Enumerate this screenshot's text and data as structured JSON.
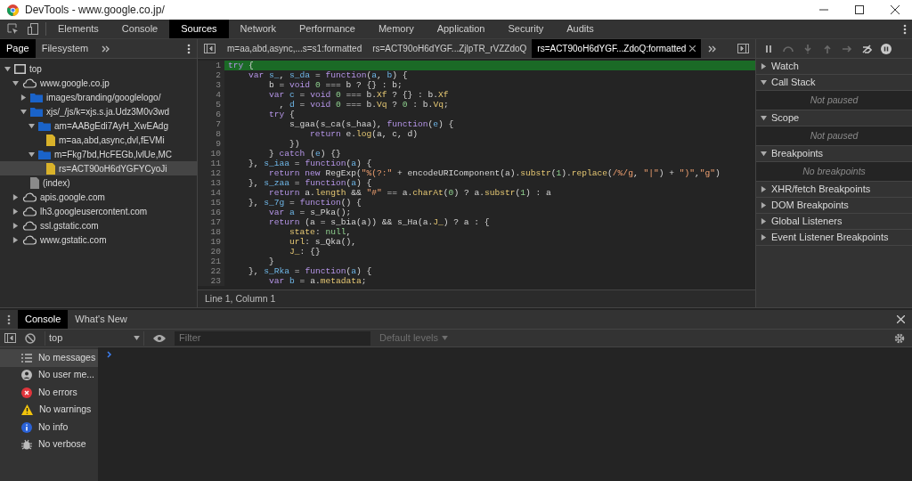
{
  "window": {
    "title": "DevTools - www.google.co.jp/"
  },
  "main_tabs": [
    {
      "label": "Elements",
      "selected": false
    },
    {
      "label": "Console",
      "selected": false
    },
    {
      "label": "Sources",
      "selected": true
    },
    {
      "label": "Network",
      "selected": false
    },
    {
      "label": "Performance",
      "selected": false
    },
    {
      "label": "Memory",
      "selected": false
    },
    {
      "label": "Application",
      "selected": false
    },
    {
      "label": "Security",
      "selected": false
    },
    {
      "label": "Audits",
      "selected": false
    }
  ],
  "navigator": {
    "tabs": [
      {
        "label": "Page",
        "selected": true
      },
      {
        "label": "Filesystem",
        "selected": false
      }
    ],
    "tree": [
      {
        "label": "top",
        "kind": "frame",
        "expanded": true,
        "selected": false,
        "children": [
          {
            "label": "www.google.co.jp",
            "kind": "domain",
            "expanded": true,
            "selected": false,
            "children": [
              {
                "label": "images/branding/googlelogo/",
                "kind": "folder",
                "expanded": false,
                "selected": false
              },
              {
                "label": "xjs/_/js/k=xjs.s.ja.Udz3M0v3wd",
                "kind": "folder",
                "expanded": true,
                "selected": false,
                "children": [
                  {
                    "label": "am=AABgEdi7AyH_XwEAdg",
                    "kind": "folder",
                    "expanded": true,
                    "selected": false,
                    "children": [
                      {
                        "label": "m=aa,abd,async,dvl,fEVMi",
                        "kind": "script",
                        "selected": false
                      }
                    ]
                  },
                  {
                    "label": "m=Fkg7bd,HcFEGb,lvlUe,MC",
                    "kind": "folder",
                    "expanded": true,
                    "selected": false,
                    "children": [
                      {
                        "label": "rs=ACT90oH6dYGFYCyoJi",
                        "kind": "script",
                        "selected": true
                      }
                    ]
                  }
                ]
              },
              {
                "label": "(index)",
                "kind": "document",
                "selected": false
              }
            ]
          },
          {
            "label": "apis.google.com",
            "kind": "domain",
            "expanded": false,
            "selected": false
          },
          {
            "label": "lh3.googleusercontent.com",
            "kind": "domain",
            "expanded": false,
            "selected": false
          },
          {
            "label": "ssl.gstatic.com",
            "kind": "domain",
            "expanded": false,
            "selected": false
          },
          {
            "label": "www.gstatic.com",
            "kind": "domain",
            "expanded": false,
            "selected": false
          }
        ]
      }
    ]
  },
  "editor": {
    "tabs": [
      {
        "label": "m=aa,abd,async,...s=s1:formatted",
        "selected": false
      },
      {
        "label": "rs=ACT90oH6dYGF...ZjlpTR_rVZZdoQ",
        "selected": false
      },
      {
        "label": "rs=ACT90oH6dYGF...ZdoQ:formatted",
        "selected": true
      }
    ],
    "lines": [
      {
        "number": "1",
        "highlighted": true,
        "tokens": [
          {
            "kind": "kw",
            "text": "try"
          },
          {
            "kind": "p",
            "text": " {"
          }
        ]
      },
      {
        "number": "2",
        "highlighted": false,
        "tokens": [
          {
            "kind": "kw",
            "text": "    var "
          },
          {
            "kind": "def",
            "text": "s_"
          },
          {
            "kind": "p",
            "text": ", "
          },
          {
            "kind": "def",
            "text": "s_da"
          },
          {
            "kind": "p",
            "text": " = "
          },
          {
            "kind": "kw",
            "text": "function"
          },
          {
            "kind": "p",
            "text": "("
          },
          {
            "kind": "def",
            "text": "a"
          },
          {
            "kind": "p",
            "text": ", "
          },
          {
            "kind": "def",
            "text": "b"
          },
          {
            "kind": "p",
            "text": ") {"
          }
        ]
      },
      {
        "number": "3",
        "highlighted": false,
        "tokens": [
          {
            "kind": "p",
            "text": "        b = "
          },
          {
            "kind": "kw",
            "text": "void "
          },
          {
            "kind": "num",
            "text": "0"
          },
          {
            "kind": "p",
            "text": " === b ? {} : b;"
          }
        ]
      },
      {
        "number": "4",
        "highlighted": false,
        "tokens": [
          {
            "kind": "kw",
            "text": "        var "
          },
          {
            "kind": "def",
            "text": "c"
          },
          {
            "kind": "p",
            "text": " = "
          },
          {
            "kind": "kw",
            "text": "void "
          },
          {
            "kind": "num",
            "text": "0"
          },
          {
            "kind": "p",
            "text": " === b."
          },
          {
            "kind": "prop",
            "text": "Xf"
          },
          {
            "kind": "p",
            "text": " ? {} : b."
          },
          {
            "kind": "prop",
            "text": "Xf"
          }
        ]
      },
      {
        "number": "5",
        "highlighted": false,
        "tokens": [
          {
            "kind": "p",
            "text": "          , "
          },
          {
            "kind": "def",
            "text": "d"
          },
          {
            "kind": "p",
            "text": " = "
          },
          {
            "kind": "kw",
            "text": "void "
          },
          {
            "kind": "num",
            "text": "0"
          },
          {
            "kind": "p",
            "text": " === b."
          },
          {
            "kind": "prop",
            "text": "Vq"
          },
          {
            "kind": "p",
            "text": " ? "
          },
          {
            "kind": "num",
            "text": "0"
          },
          {
            "kind": "p",
            "text": " : b."
          },
          {
            "kind": "prop",
            "text": "Vq"
          },
          {
            "kind": "p",
            "text": ";"
          }
        ]
      },
      {
        "number": "6",
        "highlighted": false,
        "tokens": [
          {
            "kind": "kw",
            "text": "        try"
          },
          {
            "kind": "p",
            "text": " {"
          }
        ]
      },
      {
        "number": "7",
        "highlighted": false,
        "tokens": [
          {
            "kind": "p",
            "text": "            s_gaa(s_ca(s_haa), "
          },
          {
            "kind": "kw",
            "text": "function"
          },
          {
            "kind": "p",
            "text": "("
          },
          {
            "kind": "def",
            "text": "e"
          },
          {
            "kind": "p",
            "text": ") {"
          }
        ]
      },
      {
        "number": "8",
        "highlighted": false,
        "tokens": [
          {
            "kind": "kw",
            "text": "                return"
          },
          {
            "kind": "p",
            "text": " e."
          },
          {
            "kind": "prop",
            "text": "log"
          },
          {
            "kind": "p",
            "text": "(a, c, d)"
          }
        ]
      },
      {
        "number": "9",
        "highlighted": false,
        "tokens": [
          {
            "kind": "p",
            "text": "            })"
          }
        ]
      },
      {
        "number": "10",
        "highlighted": false,
        "tokens": [
          {
            "kind": "p",
            "text": "        } "
          },
          {
            "kind": "kw",
            "text": "catch"
          },
          {
            "kind": "p",
            "text": " ("
          },
          {
            "kind": "def",
            "text": "e"
          },
          {
            "kind": "p",
            "text": ") {}"
          }
        ]
      },
      {
        "number": "11",
        "highlighted": false,
        "tokens": [
          {
            "kind": "p",
            "text": "    }, "
          },
          {
            "kind": "def",
            "text": "s_iaa"
          },
          {
            "kind": "p",
            "text": " = "
          },
          {
            "kind": "kw",
            "text": "function"
          },
          {
            "kind": "p",
            "text": "("
          },
          {
            "kind": "def",
            "text": "a"
          },
          {
            "kind": "p",
            "text": ") {"
          }
        ]
      },
      {
        "number": "12",
        "highlighted": false,
        "tokens": [
          {
            "kind": "kw",
            "text": "        return new"
          },
          {
            "kind": "p",
            "text": " RegExp("
          },
          {
            "kind": "str",
            "text": "\"%(?:\""
          },
          {
            "kind": "p",
            "text": " + encodeURIComponent(a)."
          },
          {
            "kind": "prop",
            "text": "substr"
          },
          {
            "kind": "p",
            "text": "("
          },
          {
            "kind": "num",
            "text": "1"
          },
          {
            "kind": "p",
            "text": ")."
          },
          {
            "kind": "prop",
            "text": "replace"
          },
          {
            "kind": "p",
            "text": "("
          },
          {
            "kind": "str",
            "text": "/%/g"
          },
          {
            "kind": "p",
            "text": ", "
          },
          {
            "kind": "str",
            "text": "\"|\""
          },
          {
            "kind": "p",
            "text": ") + "
          },
          {
            "kind": "str",
            "text": "\")\""
          },
          {
            "kind": "p",
            "text": ","
          },
          {
            "kind": "str",
            "text": "\"g\""
          },
          {
            "kind": "p",
            "text": ")"
          }
        ]
      },
      {
        "number": "13",
        "highlighted": false,
        "tokens": [
          {
            "kind": "p",
            "text": "    }, "
          },
          {
            "kind": "def",
            "text": "s_zaa"
          },
          {
            "kind": "p",
            "text": " = "
          },
          {
            "kind": "kw",
            "text": "function"
          },
          {
            "kind": "p",
            "text": "("
          },
          {
            "kind": "def",
            "text": "a"
          },
          {
            "kind": "p",
            "text": ") {"
          }
        ]
      },
      {
        "number": "14",
        "highlighted": false,
        "tokens": [
          {
            "kind": "kw",
            "text": "        return"
          },
          {
            "kind": "p",
            "text": " a."
          },
          {
            "kind": "prop",
            "text": "length"
          },
          {
            "kind": "p",
            "text": " && "
          },
          {
            "kind": "str",
            "text": "\"#\""
          },
          {
            "kind": "p",
            "text": " == a."
          },
          {
            "kind": "prop",
            "text": "charAt"
          },
          {
            "kind": "p",
            "text": "("
          },
          {
            "kind": "num",
            "text": "0"
          },
          {
            "kind": "p",
            "text": ") ? a."
          },
          {
            "kind": "prop",
            "text": "substr"
          },
          {
            "kind": "p",
            "text": "("
          },
          {
            "kind": "num",
            "text": "1"
          },
          {
            "kind": "p",
            "text": ") : a"
          }
        ]
      },
      {
        "number": "15",
        "highlighted": false,
        "tokens": [
          {
            "kind": "p",
            "text": "    }, "
          },
          {
            "kind": "def",
            "text": "s_7g"
          },
          {
            "kind": "p",
            "text": " = "
          },
          {
            "kind": "kw",
            "text": "function"
          },
          {
            "kind": "p",
            "text": "() {"
          }
        ]
      },
      {
        "number": "16",
        "highlighted": false,
        "tokens": [
          {
            "kind": "kw",
            "text": "        var "
          },
          {
            "kind": "def",
            "text": "a"
          },
          {
            "kind": "p",
            "text": " = s_Pka();"
          }
        ]
      },
      {
        "number": "17",
        "highlighted": false,
        "tokens": [
          {
            "kind": "kw",
            "text": "        return"
          },
          {
            "kind": "p",
            "text": " (a = s_bia(a)) && s_Ha(a."
          },
          {
            "kind": "prop",
            "text": "J_"
          },
          {
            "kind": "p",
            "text": ") ? a : {"
          }
        ]
      },
      {
        "number": "18",
        "highlighted": false,
        "tokens": [
          {
            "kind": "prop",
            "text": "            state"
          },
          {
            "kind": "p",
            "text": ": "
          },
          {
            "kind": "num",
            "text": "null"
          },
          {
            "kind": "p",
            "text": ","
          }
        ]
      },
      {
        "number": "19",
        "highlighted": false,
        "tokens": [
          {
            "kind": "prop",
            "text": "            url"
          },
          {
            "kind": "p",
            "text": ": s_Qka(),"
          }
        ]
      },
      {
        "number": "20",
        "highlighted": false,
        "tokens": [
          {
            "kind": "prop",
            "text": "            J_"
          },
          {
            "kind": "p",
            "text": ": {}"
          }
        ]
      },
      {
        "number": "21",
        "highlighted": false,
        "tokens": [
          {
            "kind": "p",
            "text": "        }"
          }
        ]
      },
      {
        "number": "22",
        "highlighted": false,
        "tokens": [
          {
            "kind": "p",
            "text": "    }, "
          },
          {
            "kind": "def",
            "text": "s_Rka"
          },
          {
            "kind": "p",
            "text": " = "
          },
          {
            "kind": "kw",
            "text": "function"
          },
          {
            "kind": "p",
            "text": "("
          },
          {
            "kind": "def",
            "text": "a"
          },
          {
            "kind": "p",
            "text": ") {"
          }
        ]
      },
      {
        "number": "23",
        "highlighted": false,
        "tokens": [
          {
            "kind": "kw",
            "text": "        var "
          },
          {
            "kind": "def",
            "text": "b"
          },
          {
            "kind": "p",
            "text": " = a."
          },
          {
            "kind": "prop",
            "text": "metadata"
          },
          {
            "kind": "p",
            "text": ";"
          }
        ]
      }
    ],
    "status": "Line 1, Column 1"
  },
  "debugger_sections": [
    {
      "title": "Watch",
      "expanded": false
    },
    {
      "title": "Call Stack",
      "expanded": true,
      "message": "Not paused"
    },
    {
      "title": "Scope",
      "expanded": true,
      "message": "Not paused"
    },
    {
      "title": "Breakpoints",
      "expanded": true,
      "message": "No breakpoints"
    },
    {
      "title": "XHR/fetch Breakpoints",
      "expanded": false
    },
    {
      "title": "DOM Breakpoints",
      "expanded": false
    },
    {
      "title": "Global Listeners",
      "expanded": false
    },
    {
      "title": "Event Listener Breakpoints",
      "expanded": false
    }
  ],
  "drawer": {
    "tabs": [
      {
        "label": "Console",
        "selected": true
      },
      {
        "label": "What's New",
        "selected": false
      }
    ],
    "context": "top",
    "filter": {
      "placeholder": "Filter"
    },
    "levels": "Default levels",
    "sidebar": [
      {
        "label": "No messages",
        "kind": "messages",
        "selected": true
      },
      {
        "label": "No user me...",
        "kind": "user",
        "selected": false
      },
      {
        "label": "No errors",
        "kind": "errors",
        "selected": false
      },
      {
        "label": "No warnings",
        "kind": "warnings",
        "selected": false
      },
      {
        "label": "No info",
        "kind": "info",
        "selected": false
      },
      {
        "label": "No verbose",
        "kind": "verbose",
        "selected": false
      }
    ]
  }
}
